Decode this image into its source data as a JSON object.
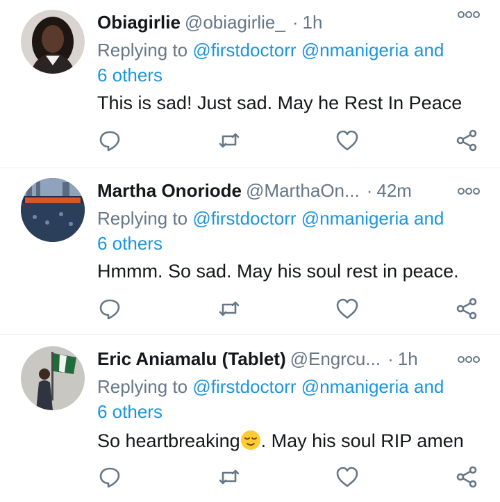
{
  "tweets": [
    {
      "name": "Obiagirlie",
      "handle": "@obiagirlie_",
      "separator": "·",
      "time": "1h",
      "replying_prefix": "Replying to ",
      "replying_targets": "@firstdoctorr @nmanigeria and",
      "replying_others": "6 others",
      "text_before": "This is sad! Just sad. May he Rest In Peace",
      "text_after": "",
      "avatar_icon": "profile-photo-woman"
    },
    {
      "name": "Martha Onoriode",
      "handle": "@MarthaOn...",
      "separator": "·",
      "time": "42m",
      "replying_prefix": "Replying to ",
      "replying_targets": "@firstdoctorr @nmanigeria and",
      "replying_others": "6 others",
      "text_before": "Hmmm. So sad. May his soul rest in peace.",
      "text_after": "",
      "avatar_icon": "profile-photo-crowd"
    },
    {
      "name": "Eric Aniamalu (Tablet)",
      "handle": "@Engrcu...",
      "separator": "·",
      "time": "1h",
      "replying_prefix": "Replying to ",
      "replying_targets": "@firstdoctorr @nmanigeria and",
      "replying_others": "6 others",
      "text_before": "So heartbreaking",
      "text_after": ". May his soul RIP amen",
      "avatar_icon": "profile-photo-flag"
    }
  ],
  "icons": {
    "more": "more-options-icon",
    "reply": "reply-icon",
    "retweet": "retweet-icon",
    "like": "like-heart-icon",
    "share": "share-icon",
    "emoji": "relieved-face-emoji"
  },
  "colors": {
    "link": "#1b95e0",
    "muted": "#657786",
    "text": "#14171a",
    "divider": "#e6ecf0"
  }
}
